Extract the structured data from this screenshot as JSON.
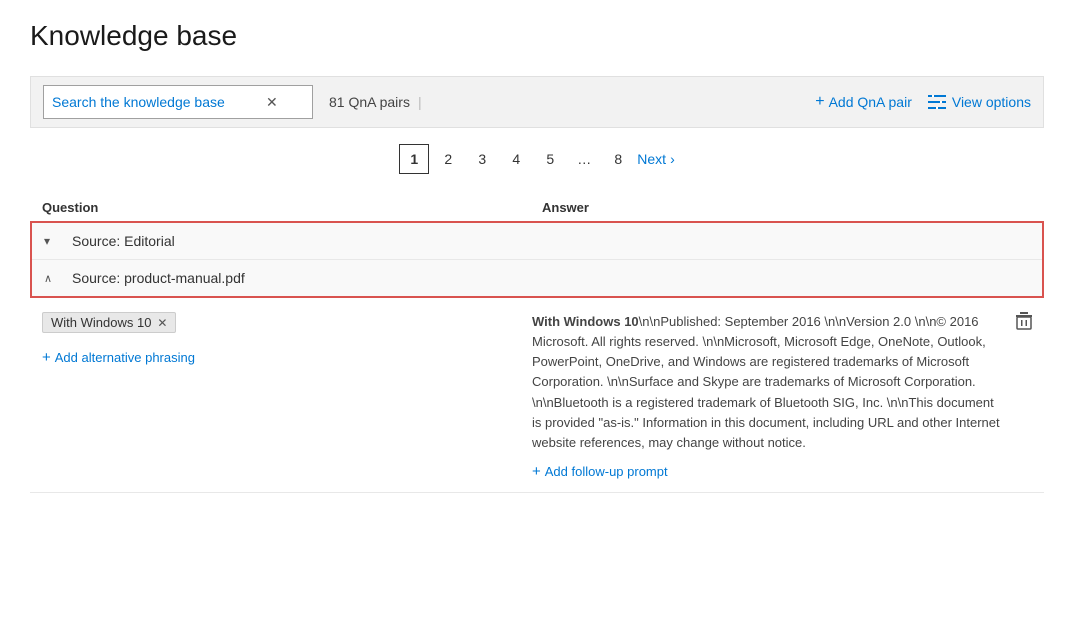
{
  "page": {
    "title": "Knowledge base"
  },
  "toolbar": {
    "search_placeholder": "Search the knowledge base",
    "search_value": "Search the knowledge base",
    "qna_count": "81 QnA pairs",
    "add_qna_label": "Add QnA pair",
    "view_options_label": "View options"
  },
  "pagination": {
    "pages": [
      "1",
      "2",
      "3",
      "4",
      "5",
      "…",
      "8"
    ],
    "active_page": "1",
    "next_label": "Next"
  },
  "table": {
    "col_question": "Question",
    "col_answer": "Answer"
  },
  "sources": [
    {
      "label": "Source: Editorial",
      "expanded": false,
      "chevron": "▾"
    },
    {
      "label": "Source: product-manual.pdf",
      "expanded": true,
      "chevron": "∧"
    }
  ],
  "qna_items": [
    {
      "question_tag": "With Windows 10",
      "add_phrasing_label": "Add alternative phrasing",
      "answer_text": "**With Windows 10**\\n\\nPublished: September 2016 \\n\\nVersion 2.0 \\n\\n© 2016 Microsoft. All rights reserved. \\n\\nMicrosoft, Microsoft Edge, OneNote, Outlook, PowerPoint, OneDrive, and Windows are registered trademarks of Microsoft Corporation. \\n\\nSurface and Skype are trademarks of Microsoft Corporation. \\n\\nBluetooth is a registered trademark of Bluetooth SIG, Inc. \\n\\nThis document is provided \"as-is.\" Information in this document, including URL and other Internet website references, may change without notice.",
      "add_followup_label": "Add follow-up prompt"
    }
  ]
}
